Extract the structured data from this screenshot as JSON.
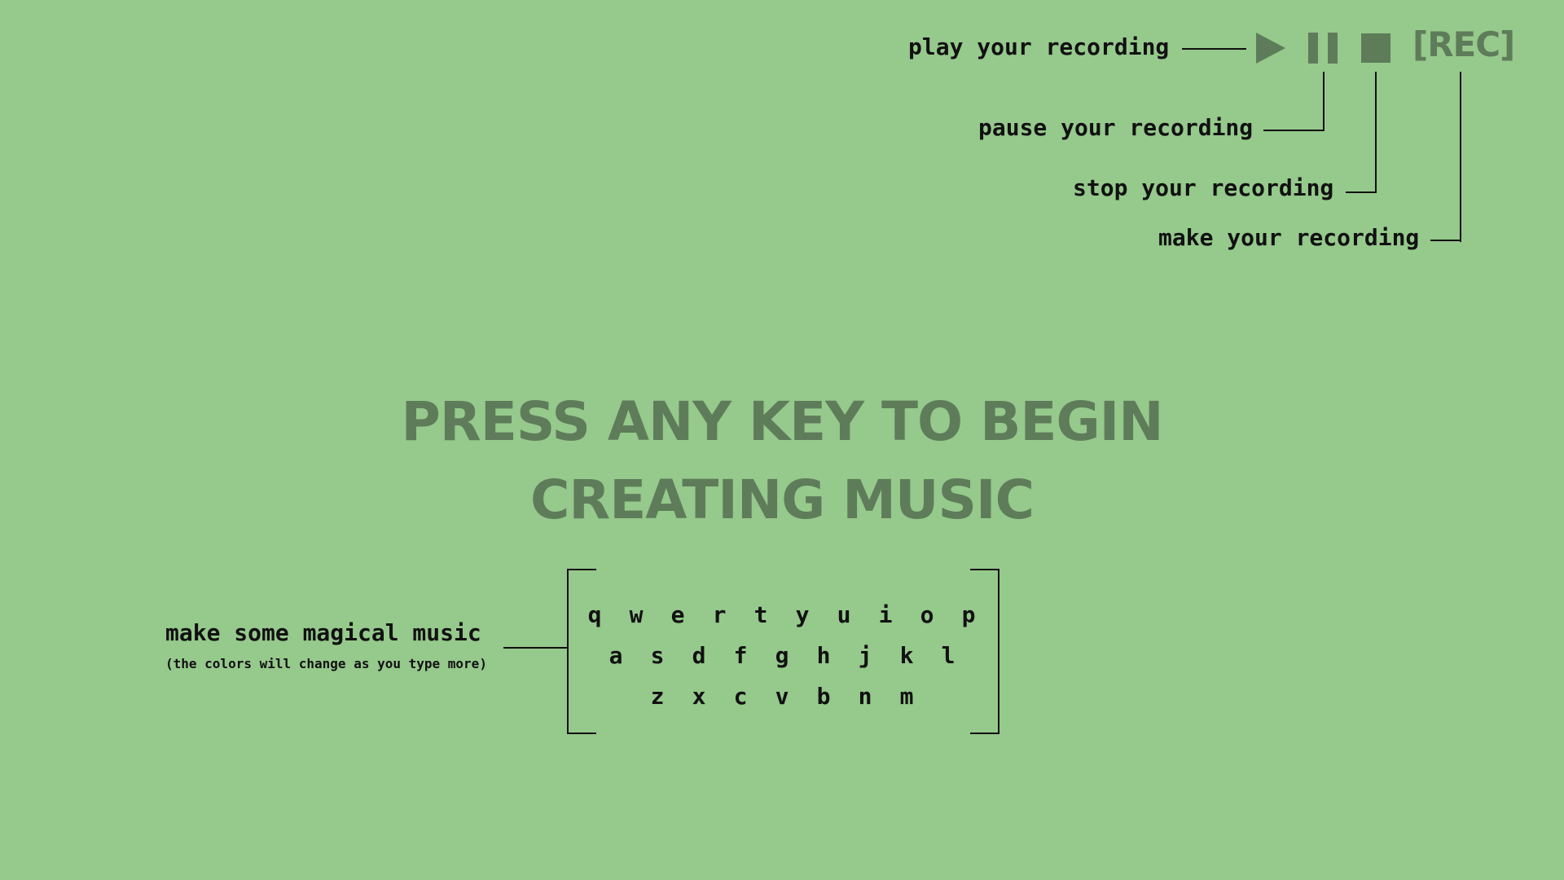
{
  "controls": {
    "play_label": "play your recording",
    "pause_label": "pause your recording",
    "stop_label": "stop your recording",
    "record_label": "make your recording",
    "rec_button": "[REC]",
    "accent_color": "#5e7c5a"
  },
  "headline": {
    "line1": "PRESS ANY KEY TO BEGIN",
    "line2": "CREATING MUSIC"
  },
  "keyboard": {
    "row1": [
      "q",
      "w",
      "e",
      "r",
      "t",
      "y",
      "u",
      "i",
      "o",
      "p"
    ],
    "row2": [
      "a",
      "s",
      "d",
      "f",
      "g",
      "h",
      "j",
      "k",
      "l"
    ],
    "row3": [
      "z",
      "x",
      "c",
      "v",
      "b",
      "n",
      "m"
    ]
  },
  "hint": {
    "title": "make some magical music",
    "subtitle": "(the colors will change as you type more)"
  },
  "colors": {
    "background": "#96c98c",
    "text": "#111111"
  }
}
